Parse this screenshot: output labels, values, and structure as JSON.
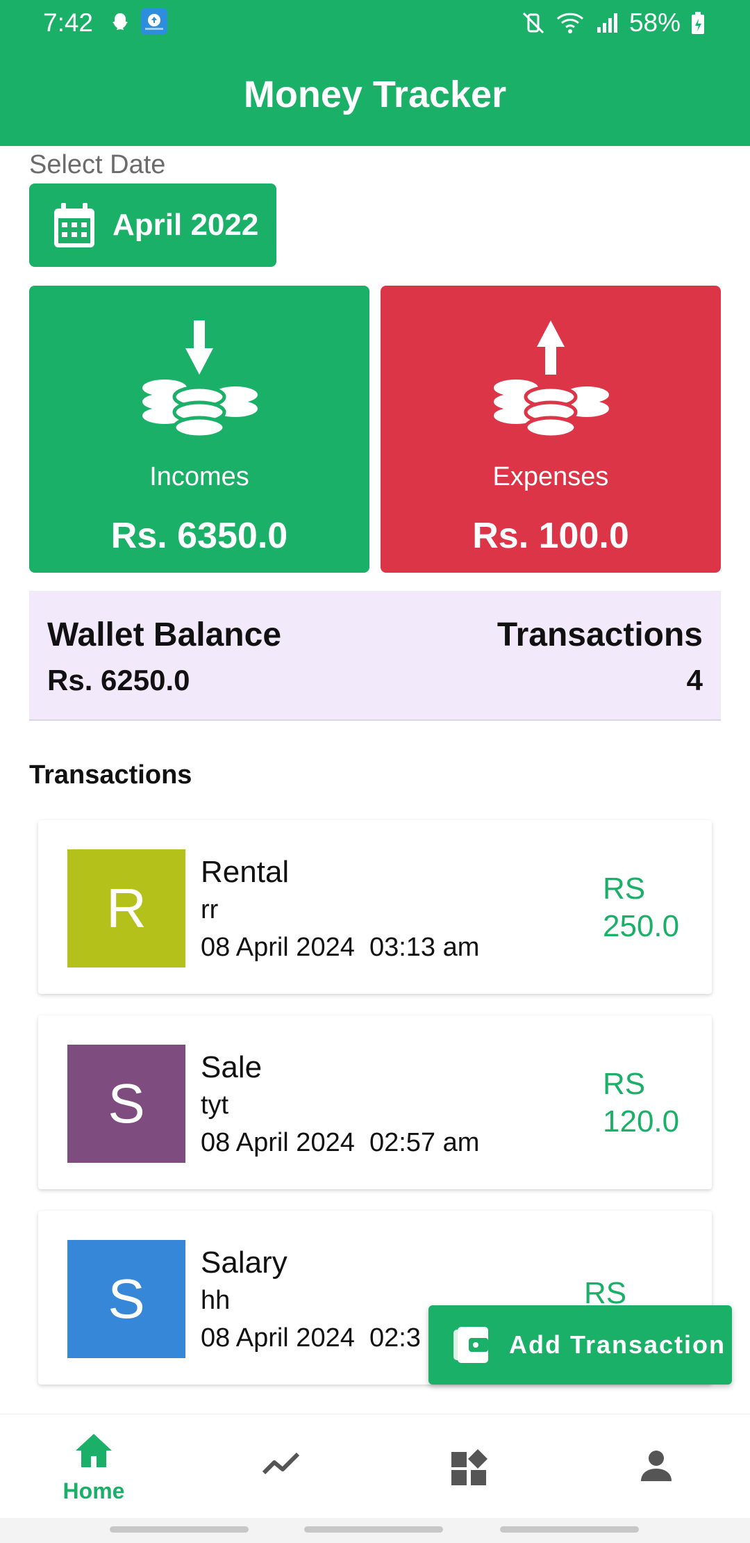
{
  "status_bar": {
    "time": "7:42",
    "battery": "58%",
    "icons": [
      "snapchat-icon",
      "cloud-upload-icon",
      "mute-vibrate-icon",
      "wifi-icon",
      "signal-icon",
      "battery-icon"
    ]
  },
  "app_bar": {
    "title": "Money Tracker"
  },
  "date_selector": {
    "label": "Select Date",
    "value": "April 2022",
    "icon": "calendar-icon"
  },
  "summary": {
    "income": {
      "label": "Incomes",
      "amount": "Rs. 6350.0",
      "color": "#1BB068",
      "icon": "coins-down-icon"
    },
    "expense": {
      "label": "Expenses",
      "amount": "Rs. 100.0",
      "color": "#DD3548",
      "icon": "coins-up-icon"
    }
  },
  "wallet": {
    "balance_label": "Wallet Balance",
    "balance_value": "Rs. 6250.0",
    "transactions_label": "Transactions",
    "transactions_value": "4"
  },
  "transactions": {
    "title": "Transactions",
    "items": [
      {
        "initial": "R",
        "name": "Rental",
        "note": "rr",
        "date": "08 April 2024  03:13 am",
        "currency": "RS",
        "amount": "250.0",
        "color": "#B5C11B"
      },
      {
        "initial": "S",
        "name": "Sale",
        "note": "tyt",
        "date": "08 April 2024  02:57 am",
        "currency": "RS",
        "amount": "120.0",
        "color": "#7E4C7E"
      },
      {
        "initial": "S",
        "name": "Salary",
        "note": "hh",
        "date": "08 April 2024  02:3",
        "currency": "RS",
        "amount": "",
        "color": "#3787D9"
      }
    ]
  },
  "fab": {
    "label": "Add Transaction",
    "icon": "wallet-icon"
  },
  "bottom_nav": {
    "items": [
      {
        "label": "Home",
        "icon": "home-icon",
        "active": true
      },
      {
        "label": "",
        "icon": "trending-icon",
        "active": false
      },
      {
        "label": "",
        "icon": "widgets-icon",
        "active": false
      },
      {
        "label": "",
        "icon": "person-icon",
        "active": false
      }
    ],
    "active_color": "#1BB068",
    "inactive_color": "#555555"
  }
}
